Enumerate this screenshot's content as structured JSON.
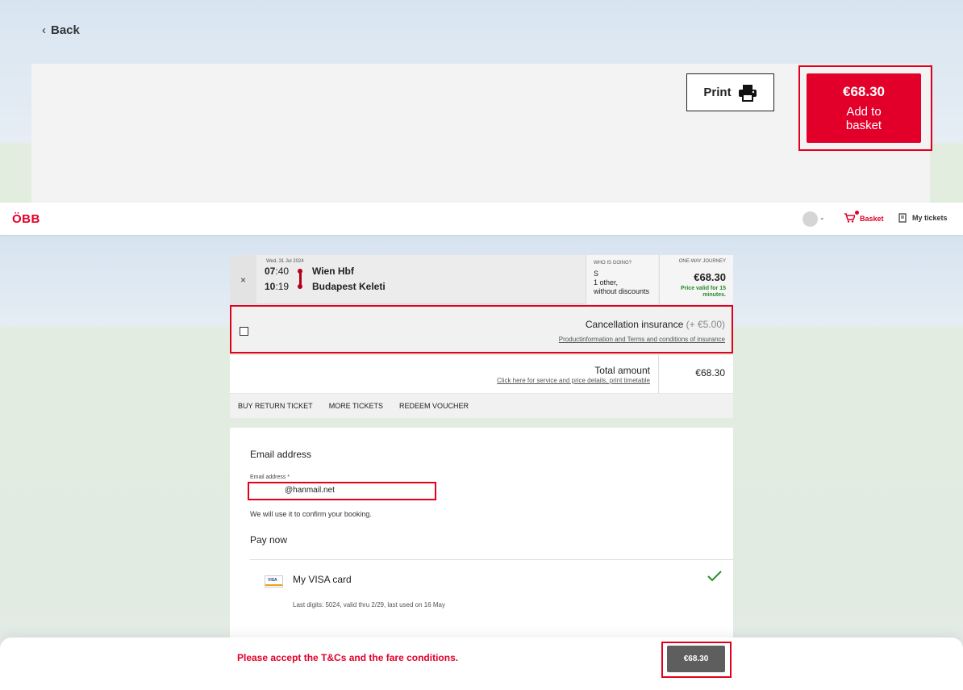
{
  "nav": {
    "back_label": "Back"
  },
  "top_actions": {
    "print_label": "Print",
    "price": "€68.30",
    "add_label": "Add to basket"
  },
  "header": {
    "logo": "ÖBB",
    "basket_label": "Basket",
    "tickets_label": "My tickets"
  },
  "journey": {
    "close": "×",
    "date": "Wed, 31 Jul 2024",
    "dep_h": "07",
    "dep_m": ":40",
    "arr_h": "10",
    "arr_m": ":19",
    "from": "Wien Hbf",
    "to": "Budapest Keleti",
    "who_head": "WHO IS GOING?",
    "who_line1": "S",
    "who_line2": "1 other,",
    "who_line3": "without discounts",
    "fare_head": "ONE-WAY JOURNEY",
    "fare_price": "€68.30",
    "fare_valid": "Price valid for 15 minutes."
  },
  "insurance": {
    "label": "Cancellation insurance",
    "extra": "(+ €5.00)",
    "link": "Productinformation and Terms and conditions of insurance"
  },
  "total": {
    "label": "Total amount",
    "link": "Click here for service and price details, print timetable",
    "value": "€68.30"
  },
  "actions": [
    "BUY RETURN TICKET",
    "MORE TICKETS",
    "REDEEM VOUCHER"
  ],
  "email": {
    "title": "Email address",
    "label": "Email address *",
    "value": "@hanmail.net",
    "hint": "We will use it to confirm your booking."
  },
  "payment": {
    "title": "Pay now",
    "card": "My VISA card",
    "card_icon": "VISA",
    "last_digits": "Last digits: 5024, valid thru 2/29, last used on 16 May"
  },
  "footer": {
    "warning": "Please accept the T&Cs and the fare conditions.",
    "pay": "€68.30"
  },
  "colors": {
    "brand_red": "#e2002a",
    "green": "#2a8a2a"
  }
}
